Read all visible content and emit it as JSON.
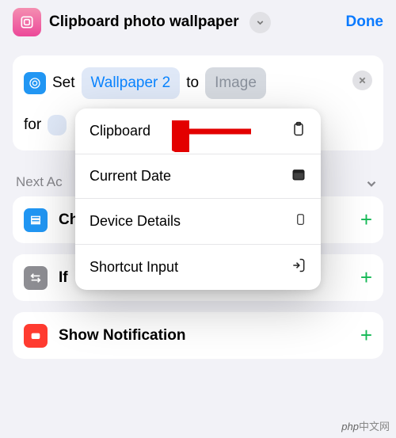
{
  "header": {
    "title": "Clipboard photo wallpaper",
    "done_label": "Done"
  },
  "set_card": {
    "verb": "Set",
    "token_wallpaper": "Wallpaper 2",
    "to": "to",
    "token_image": "Image",
    "for": "for"
  },
  "section_next_actions": "Next Ac",
  "actions": [
    {
      "label": "Ch"
    },
    {
      "label": "If"
    },
    {
      "label": "Show Notification"
    }
  ],
  "popover": {
    "items": [
      {
        "label": "Clipboard",
        "icon": "clipboard-icon"
      },
      {
        "label": "Current Date",
        "icon": "calendar-icon"
      },
      {
        "label": "Device Details",
        "icon": "phone-icon"
      },
      {
        "label": "Shortcut Input",
        "icon": "input-icon"
      }
    ]
  },
  "watermark": {
    "left": "php",
    "right": "中文网"
  }
}
